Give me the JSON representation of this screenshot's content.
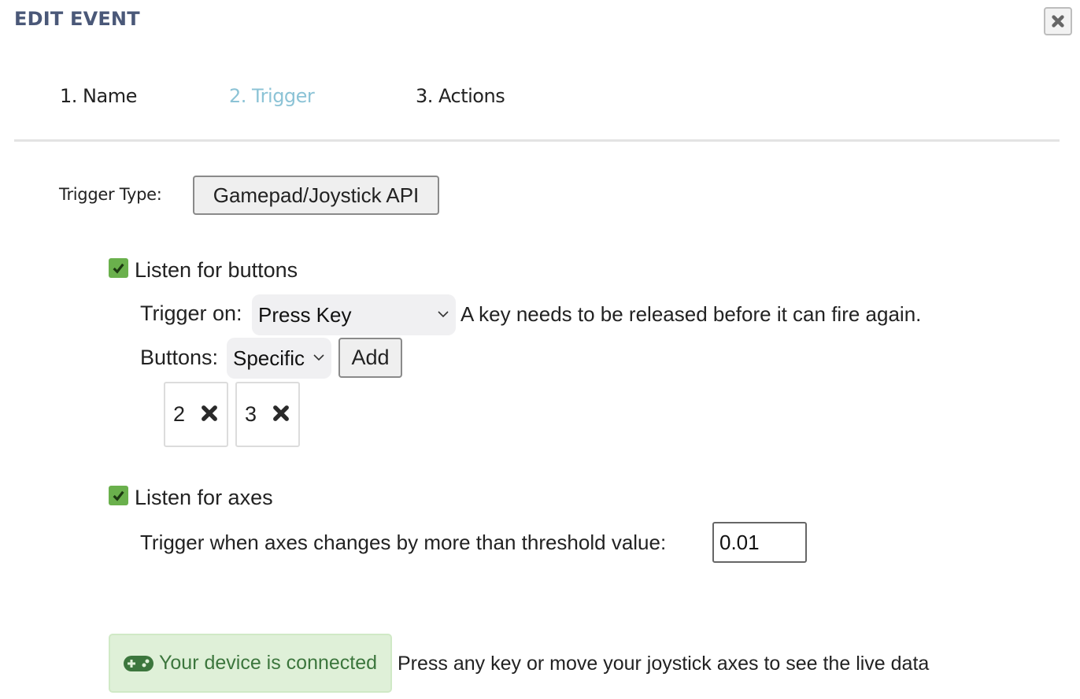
{
  "dialog": {
    "title": "EDIT EVENT",
    "close_icon": "close-icon"
  },
  "tabs": [
    {
      "label": "1. Name",
      "active": false
    },
    {
      "label": "2. Trigger",
      "active": true
    },
    {
      "label": "3. Actions",
      "active": false
    }
  ],
  "colors": {
    "title": "#4a5878",
    "active_tab": "#8cc3d6",
    "checkbox": "#6ab04c",
    "success_bg": "#dff0d8",
    "success_text": "#3c763d"
  },
  "trigger": {
    "type_label": "Trigger Type:",
    "type_value": "Gamepad/Joystick API"
  },
  "buttons_section": {
    "checkbox_label": "Listen for buttons",
    "checked": true,
    "trigger_on_label": "Trigger on:",
    "trigger_on_value": "Press Key",
    "trigger_on_hint": "A key needs to be released before it can fire again.",
    "buttons_label": "Buttons:",
    "buttons_value": "Specific",
    "add_label": "Add",
    "selected_buttons": [
      "2",
      "3"
    ]
  },
  "axes_section": {
    "checkbox_label": "Listen for axes",
    "checked": true,
    "threshold_label": "Trigger when axes changes by more than threshold value:",
    "threshold_value": "0.01"
  },
  "status": {
    "icon": "gamepad-icon",
    "connected_text": "Your device is connected",
    "hint": "Press any key or move your joystick axes to see the live data"
  }
}
